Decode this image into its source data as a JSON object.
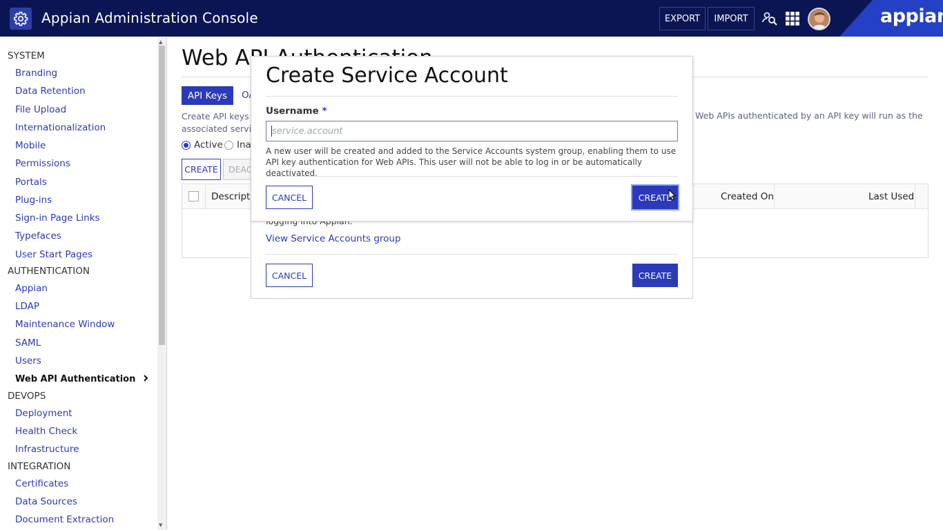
{
  "header": {
    "title": "Appian Administration Console",
    "export_label": "EXPORT",
    "import_label": "IMPORT",
    "brand": "appian"
  },
  "sidebar": {
    "sections": [
      {
        "label": "SYSTEM",
        "items": [
          "Branding",
          "Data Retention",
          "File Upload",
          "Internationalization",
          "Mobile",
          "Permissions",
          "Portals",
          "Plug-ins",
          "Sign-in Page Links",
          "Typefaces",
          "User Start Pages"
        ]
      },
      {
        "label": "AUTHENTICATION",
        "items": [
          "Appian",
          "LDAP",
          "Maintenance Window",
          "SAML",
          "Users",
          "Web API Authentication"
        ]
      },
      {
        "label": "DEVOPS",
        "items": [
          "Deployment",
          "Health Check",
          "Infrastructure"
        ]
      },
      {
        "label": "INTEGRATION",
        "items": [
          "Certificates",
          "Data Sources",
          "Document Extraction"
        ]
      }
    ],
    "active_item": "Web API Authentication"
  },
  "page": {
    "title": "Web API Authentication",
    "tabs": [
      "API Keys",
      "OA"
    ],
    "description_left": "Create API keys an associated service",
    "description_right": "Web APIs authenticated by an API key will run as the",
    "radio_active": "Active",
    "radio_inactive": "Inac",
    "create_label": "CREATE",
    "deactivate_label": "DEACT",
    "columns": [
      "Descriptio",
      "Created On",
      "Last Used"
    ]
  },
  "back_modal": {
    "text": "logging into Appian.",
    "link": "View Service Accounts group",
    "cancel_label": "CANCEL",
    "create_label": "CREATE"
  },
  "modal": {
    "title": "Create Service Account",
    "field_label": "Username",
    "required_mark": "*",
    "placeholder": "service.account",
    "help_text": "A new user will be created and added to the Service Accounts system group, enabling them to use API key authentication for Web APIs. This user will not be able to log in or be automatically deactivated.",
    "cancel_label": "CANCEL",
    "create_label": "CREATE"
  },
  "colors": {
    "header_bg": "#0b1554",
    "accent": "#2b3ab8",
    "brand_bg": "#2440c4"
  }
}
